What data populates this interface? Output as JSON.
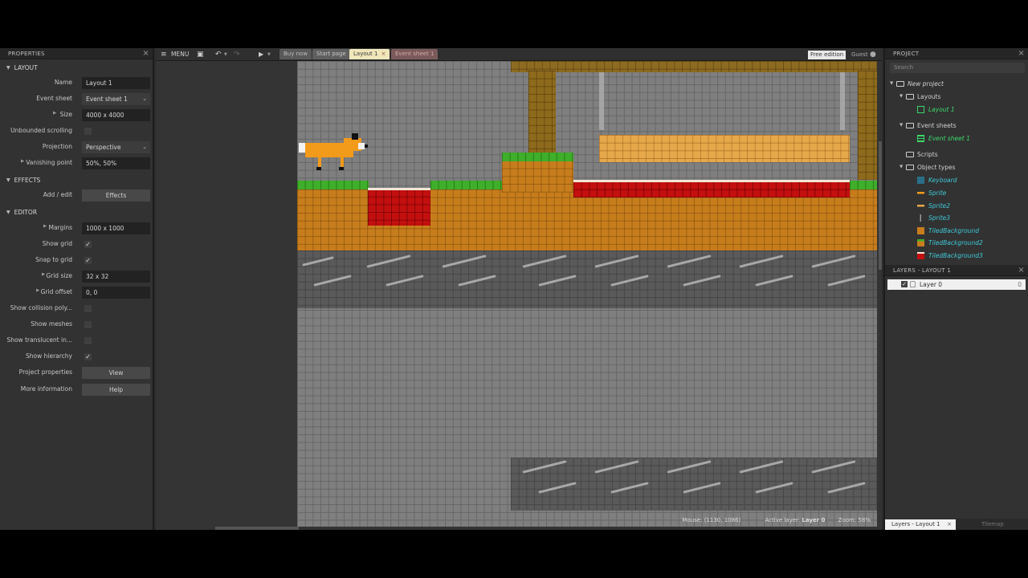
{
  "properties": {
    "title": "PROPERTIES",
    "sections": {
      "layout": "LAYOUT",
      "effects": "EFFECTS",
      "editor": "EDITOR"
    },
    "rows": {
      "name": {
        "label": "Name",
        "value": "Layout 1"
      },
      "event_sheet": {
        "label": "Event sheet",
        "value": "Event sheet 1"
      },
      "size": {
        "label": "Size",
        "value": "4000 x 4000"
      },
      "unbounded": {
        "label": "Unbounded scrolling",
        "checked": false
      },
      "projection": {
        "label": "Projection",
        "value": "Perspective"
      },
      "vanishing": {
        "label": "Vanishing point",
        "value": "50%, 50%"
      },
      "add_edit": {
        "label": "Add / edit",
        "button": "Effects"
      },
      "margins": {
        "label": "Margins",
        "value": "1000 x 1000"
      },
      "show_grid": {
        "label": "Show grid",
        "checked": true
      },
      "snap_grid": {
        "label": "Snap to grid",
        "checked": true
      },
      "grid_size": {
        "label": "Grid size",
        "value": "32 x 32"
      },
      "grid_offset": {
        "label": "Grid offset",
        "value": "0, 0"
      },
      "show_collision": {
        "label": "Show collision poly...",
        "checked": false
      },
      "show_meshes": {
        "label": "Show meshes",
        "checked": false
      },
      "show_translucent": {
        "label": "Show translucent in...",
        "checked": false
      },
      "show_hierarchy": {
        "label": "Show hierarchy",
        "checked": true
      },
      "project_props": {
        "label": "Project properties",
        "button": "View"
      },
      "more_info": {
        "label": "More information",
        "button": "Help"
      }
    }
  },
  "toolbar": {
    "menu": "MENU",
    "tabs": [
      "Buy now",
      "Start page",
      "Layout 1",
      "Event sheet 1"
    ],
    "edition": "Free edition",
    "user": "Guest"
  },
  "status": {
    "mouse": "Mouse: (1130, 1086)",
    "active_layer_label": "Active layer: ",
    "active_layer": "Layer 0",
    "zoom": "Zoom: 58%"
  },
  "project": {
    "title": "PROJECT",
    "search_placeholder": "Search",
    "root": "New project",
    "layouts": "Layouts",
    "layout_item": "Layout 1",
    "event_sheets": "Event sheets",
    "event_sheet_item": "Event sheet 1",
    "scripts": "Scripts",
    "object_types": "Object types",
    "objects": [
      "Keyboard",
      "Sprite",
      "Sprite2",
      "Sprite3",
      "TiledBackground",
      "TiledBackground2",
      "TiledBackground3"
    ]
  },
  "layers": {
    "title": "LAYERS - LAYOUT 1",
    "items": [
      {
        "name": "Layer 0",
        "count": "0"
      }
    ]
  },
  "bottom_tabs": [
    "Layers - Layout 1",
    "Tilemap"
  ],
  "colors": {
    "dirt": "#c77d1c",
    "grass": "#3fae2a",
    "hazard": "#c30f0f",
    "active_tab": "#efe6ba",
    "accent_cyan": "#3fc8d8",
    "accent_green": "#3ad86a"
  }
}
